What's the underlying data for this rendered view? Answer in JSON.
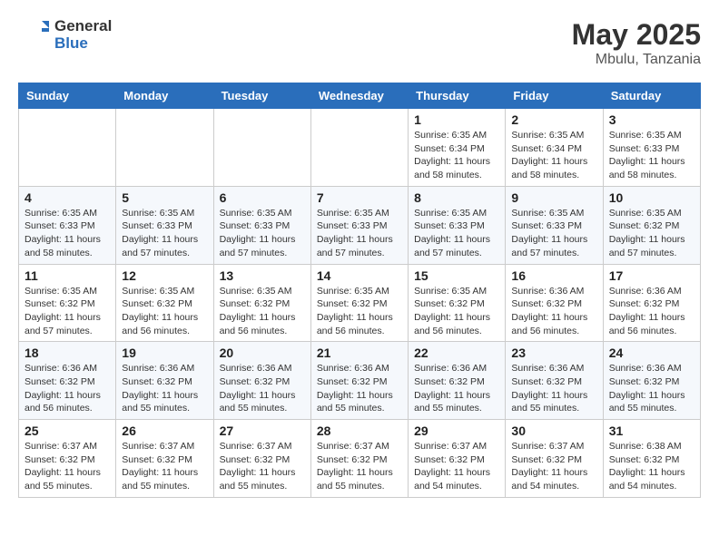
{
  "header": {
    "logo_general": "General",
    "logo_blue": "Blue",
    "month_year": "May 2025",
    "location": "Mbulu, Tanzania"
  },
  "days_of_week": [
    "Sunday",
    "Monday",
    "Tuesday",
    "Wednesday",
    "Thursday",
    "Friday",
    "Saturday"
  ],
  "weeks": [
    [
      {
        "day": "",
        "detail": ""
      },
      {
        "day": "",
        "detail": ""
      },
      {
        "day": "",
        "detail": ""
      },
      {
        "day": "",
        "detail": ""
      },
      {
        "day": "1",
        "detail": "Sunrise: 6:35 AM\nSunset: 6:34 PM\nDaylight: 11 hours and 58 minutes."
      },
      {
        "day": "2",
        "detail": "Sunrise: 6:35 AM\nSunset: 6:34 PM\nDaylight: 11 hours and 58 minutes."
      },
      {
        "day": "3",
        "detail": "Sunrise: 6:35 AM\nSunset: 6:33 PM\nDaylight: 11 hours and 58 minutes."
      }
    ],
    [
      {
        "day": "4",
        "detail": "Sunrise: 6:35 AM\nSunset: 6:33 PM\nDaylight: 11 hours and 58 minutes."
      },
      {
        "day": "5",
        "detail": "Sunrise: 6:35 AM\nSunset: 6:33 PM\nDaylight: 11 hours and 57 minutes."
      },
      {
        "day": "6",
        "detail": "Sunrise: 6:35 AM\nSunset: 6:33 PM\nDaylight: 11 hours and 57 minutes."
      },
      {
        "day": "7",
        "detail": "Sunrise: 6:35 AM\nSunset: 6:33 PM\nDaylight: 11 hours and 57 minutes."
      },
      {
        "day": "8",
        "detail": "Sunrise: 6:35 AM\nSunset: 6:33 PM\nDaylight: 11 hours and 57 minutes."
      },
      {
        "day": "9",
        "detail": "Sunrise: 6:35 AM\nSunset: 6:33 PM\nDaylight: 11 hours and 57 minutes."
      },
      {
        "day": "10",
        "detail": "Sunrise: 6:35 AM\nSunset: 6:32 PM\nDaylight: 11 hours and 57 minutes."
      }
    ],
    [
      {
        "day": "11",
        "detail": "Sunrise: 6:35 AM\nSunset: 6:32 PM\nDaylight: 11 hours and 57 minutes."
      },
      {
        "day": "12",
        "detail": "Sunrise: 6:35 AM\nSunset: 6:32 PM\nDaylight: 11 hours and 56 minutes."
      },
      {
        "day": "13",
        "detail": "Sunrise: 6:35 AM\nSunset: 6:32 PM\nDaylight: 11 hours and 56 minutes."
      },
      {
        "day": "14",
        "detail": "Sunrise: 6:35 AM\nSunset: 6:32 PM\nDaylight: 11 hours and 56 minutes."
      },
      {
        "day": "15",
        "detail": "Sunrise: 6:35 AM\nSunset: 6:32 PM\nDaylight: 11 hours and 56 minutes."
      },
      {
        "day": "16",
        "detail": "Sunrise: 6:36 AM\nSunset: 6:32 PM\nDaylight: 11 hours and 56 minutes."
      },
      {
        "day": "17",
        "detail": "Sunrise: 6:36 AM\nSunset: 6:32 PM\nDaylight: 11 hours and 56 minutes."
      }
    ],
    [
      {
        "day": "18",
        "detail": "Sunrise: 6:36 AM\nSunset: 6:32 PM\nDaylight: 11 hours and 56 minutes."
      },
      {
        "day": "19",
        "detail": "Sunrise: 6:36 AM\nSunset: 6:32 PM\nDaylight: 11 hours and 55 minutes."
      },
      {
        "day": "20",
        "detail": "Sunrise: 6:36 AM\nSunset: 6:32 PM\nDaylight: 11 hours and 55 minutes."
      },
      {
        "day": "21",
        "detail": "Sunrise: 6:36 AM\nSunset: 6:32 PM\nDaylight: 11 hours and 55 minutes."
      },
      {
        "day": "22",
        "detail": "Sunrise: 6:36 AM\nSunset: 6:32 PM\nDaylight: 11 hours and 55 minutes."
      },
      {
        "day": "23",
        "detail": "Sunrise: 6:36 AM\nSunset: 6:32 PM\nDaylight: 11 hours and 55 minutes."
      },
      {
        "day": "24",
        "detail": "Sunrise: 6:36 AM\nSunset: 6:32 PM\nDaylight: 11 hours and 55 minutes."
      }
    ],
    [
      {
        "day": "25",
        "detail": "Sunrise: 6:37 AM\nSunset: 6:32 PM\nDaylight: 11 hours and 55 minutes."
      },
      {
        "day": "26",
        "detail": "Sunrise: 6:37 AM\nSunset: 6:32 PM\nDaylight: 11 hours and 55 minutes."
      },
      {
        "day": "27",
        "detail": "Sunrise: 6:37 AM\nSunset: 6:32 PM\nDaylight: 11 hours and 55 minutes."
      },
      {
        "day": "28",
        "detail": "Sunrise: 6:37 AM\nSunset: 6:32 PM\nDaylight: 11 hours and 55 minutes."
      },
      {
        "day": "29",
        "detail": "Sunrise: 6:37 AM\nSunset: 6:32 PM\nDaylight: 11 hours and 54 minutes."
      },
      {
        "day": "30",
        "detail": "Sunrise: 6:37 AM\nSunset: 6:32 PM\nDaylight: 11 hours and 54 minutes."
      },
      {
        "day": "31",
        "detail": "Sunrise: 6:38 AM\nSunset: 6:32 PM\nDaylight: 11 hours and 54 minutes."
      }
    ]
  ]
}
